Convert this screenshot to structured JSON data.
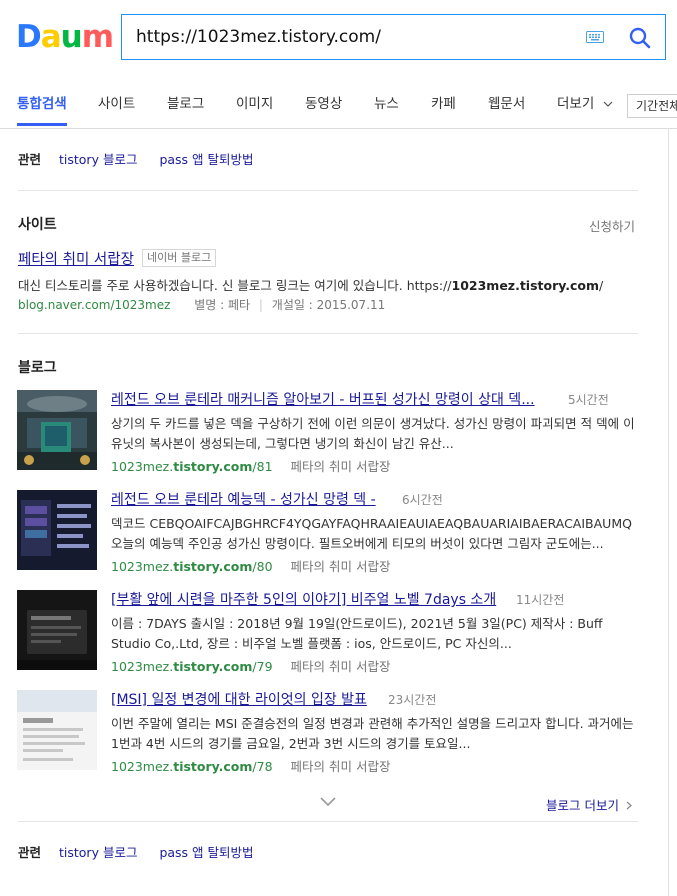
{
  "logo": {
    "letters": [
      "D",
      "a",
      "u",
      "m"
    ],
    "colors": [
      "#2a78ff",
      "#ffcd00",
      "#00b843",
      "#ff5b5b"
    ]
  },
  "search": {
    "value": "https://1023mez.tistory.com/"
  },
  "tabs": [
    {
      "label": "통합검색",
      "active": true
    },
    {
      "label": "사이트"
    },
    {
      "label": "블로그"
    },
    {
      "label": "이미지"
    },
    {
      "label": "동영상"
    },
    {
      "label": "뉴스"
    },
    {
      "label": "카페"
    },
    {
      "label": "웹문서"
    },
    {
      "label": "더보기"
    }
  ],
  "period_filter": "기간전체",
  "related_top": {
    "label": "관련",
    "links": [
      "tistory 블로그",
      "pass 앱 탈퇴방법"
    ]
  },
  "site_section": {
    "title": "사이트",
    "apply": "신청하기",
    "result": {
      "name": "페타의 취미 서랍장",
      "badge": "네이버 블로그",
      "desc_prefix": "대신 티스토리를 주로 사용하겠습니다. 신 블로그 링크는 여기에 있습니다. https://",
      "desc_bold": "1023mez.tistory.com",
      "desc_suffix": "/",
      "url": "blog.naver.com/1023mez",
      "alias": "별명 : 페타",
      "opened": "개설일 : 2015.07.11"
    }
  },
  "blog_section": {
    "title": "블로그",
    "items": [
      {
        "title": "레전드 오브 룬테라 매커니즘 알아보기 - 버프된 성가신 망령이 상대 덱...",
        "time": "5시간전",
        "desc": "상기의 두 카드를 넣은 덱을 구상하기 전에 이런 의문이 생겨났다. 성가신 망령이 파괴되면 적 덱에 이 유닛의 복사본이 생성되는데, 그렇다면 냉기의 화신이 남긴 유산...",
        "url_pre": "1023mez.",
        "url_bold": "tistory.com",
        "url_post": "/81",
        "blog": "페타의 취미 서랍장"
      },
      {
        "title": "레전드 오브 룬테라 예능덱 - 성가신 망령 덱 -",
        "time": "6시간전",
        "desc": "덱코드 CEBQOAIFCAJBGHRCF4YQGAYFAQHRAAIEAUIAEAQBAUARIAIBAERACAIBAUMQ 오늘의 예능덱 주인공 성가신 망령이다. 필트오버에게 티모의 버섯이 있다면 그림자 군도에는...",
        "url_pre": "1023mez.",
        "url_bold": "tistory.com",
        "url_post": "/80",
        "blog": "페타의 취미 서랍장"
      },
      {
        "title": "[부활 앞에 시련을 마주한 5인의 이야기] 비주얼 노벨 7days 소개",
        "time": "11시간전",
        "desc": "이름 : 7DAYS 출시일 : 2018년 9월 19일(안드로이드), 2021년 5월 3일(PC) 제작사 : Buff Studio Co,.Ltd, 장르 : 비주얼 노벨 플랫폼 : ios, 안드로이드, PC 자신의...",
        "url_pre": "1023mez.",
        "url_bold": "tistory.com",
        "url_post": "/79",
        "blog": "페타의 취미 서랍장"
      },
      {
        "title": "[MSI] 일정 변경에 대한 라이엇의 입장 발표",
        "time": "23시간전",
        "desc": "이번 주말에 열리는 MSI 준결승전의 일정 변경과 관련해 추가적인 설명을 드리고자 합니다. 과거에는 1번과 4번 시드의 경기를 금요일, 2번과 3번 시드의 경기를 토요일...",
        "url_pre": "1023mez.",
        "url_bold": "tistory.com",
        "url_post": "/78",
        "blog": "페타의 취미 서랍장"
      }
    ],
    "more": "블로그 더보기"
  },
  "related_bottom": {
    "label": "관련",
    "links": [
      "tistory 블로그",
      "pass 앱 탈퇴방법"
    ]
  }
}
